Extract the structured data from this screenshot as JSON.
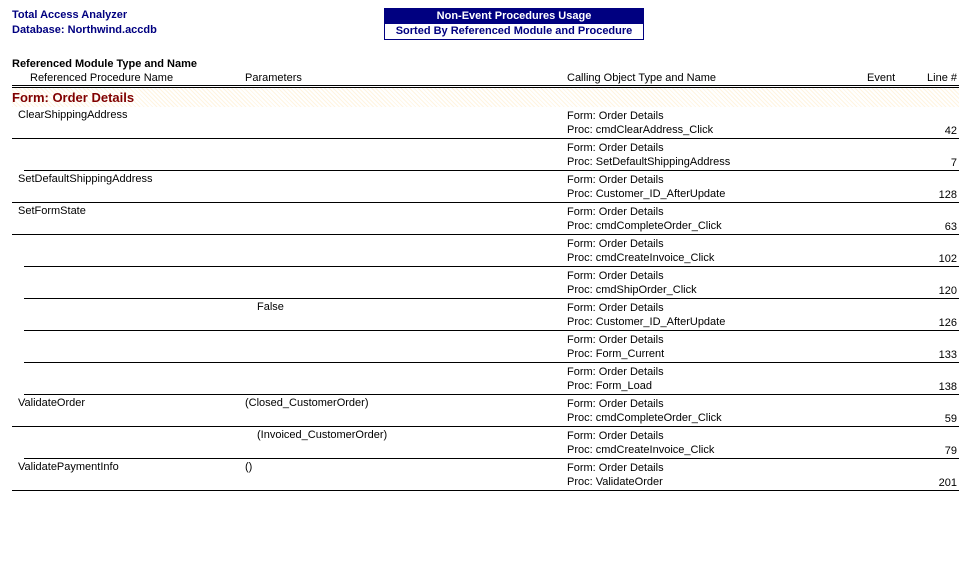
{
  "header": {
    "app_name": "Total Access Analyzer",
    "database_label": "Database: Northwind.accdb",
    "title_top": "Non-Event Procedures Usage",
    "title_bottom": "Sorted By Referenced Module and Procedure"
  },
  "section": {
    "heading": "Referenced Module Type and Name"
  },
  "columns": {
    "proc": "Referenced Procedure Name",
    "params": "Parameters",
    "calling": "Calling Object Type and Name",
    "event": "Event",
    "line": "Line #"
  },
  "group": {
    "name": "Form: Order Details"
  },
  "rows": [
    {
      "proc": "ClearShippingAddress",
      "params": "",
      "form": "Form: Order Details",
      "procCall": "Proc: cmdClearAddress_Click",
      "line": "42",
      "indent": false
    },
    {
      "proc": "",
      "params": "",
      "form": "Form: Order Details",
      "procCall": "Proc: SetDefaultShippingAddress",
      "line": "7",
      "indent": true
    },
    {
      "proc": "SetDefaultShippingAddress",
      "params": "",
      "form": "Form: Order Details",
      "procCall": "Proc: Customer_ID_AfterUpdate",
      "line": "128",
      "indent": false
    },
    {
      "proc": "SetFormState",
      "params": "",
      "form": "Form: Order Details",
      "procCall": "Proc: cmdCompleteOrder_Click",
      "line": "63",
      "indent": false
    },
    {
      "proc": "",
      "params": "",
      "form": "Form: Order Details",
      "procCall": "Proc: cmdCreateInvoice_Click",
      "line": "102",
      "indent": true
    },
    {
      "proc": "",
      "params": "",
      "form": "Form: Order Details",
      "procCall": "Proc: cmdShipOrder_Click",
      "line": "120",
      "indent": true
    },
    {
      "proc": "",
      "params": "False",
      "form": "Form: Order Details",
      "procCall": "Proc: Customer_ID_AfterUpdate",
      "line": "126",
      "indent": true
    },
    {
      "proc": "",
      "params": "",
      "form": "Form: Order Details",
      "procCall": "Proc: Form_Current",
      "line": "133",
      "indent": true
    },
    {
      "proc": "",
      "params": "",
      "form": "Form: Order Details",
      "procCall": "Proc: Form_Load",
      "line": "138",
      "indent": true
    },
    {
      "proc": "ValidateOrder",
      "params": "(Closed_CustomerOrder)",
      "form": "Form: Order Details",
      "procCall": "Proc: cmdCompleteOrder_Click",
      "line": "59",
      "indent": false
    },
    {
      "proc": "",
      "params": "(Invoiced_CustomerOrder)",
      "form": "Form: Order Details",
      "procCall": "Proc: cmdCreateInvoice_Click",
      "line": "79",
      "indent": true
    },
    {
      "proc": "ValidatePaymentInfo",
      "params": "()",
      "form": "Form: Order Details",
      "procCall": "Proc: ValidateOrder",
      "line": "201",
      "indent": false
    }
  ]
}
